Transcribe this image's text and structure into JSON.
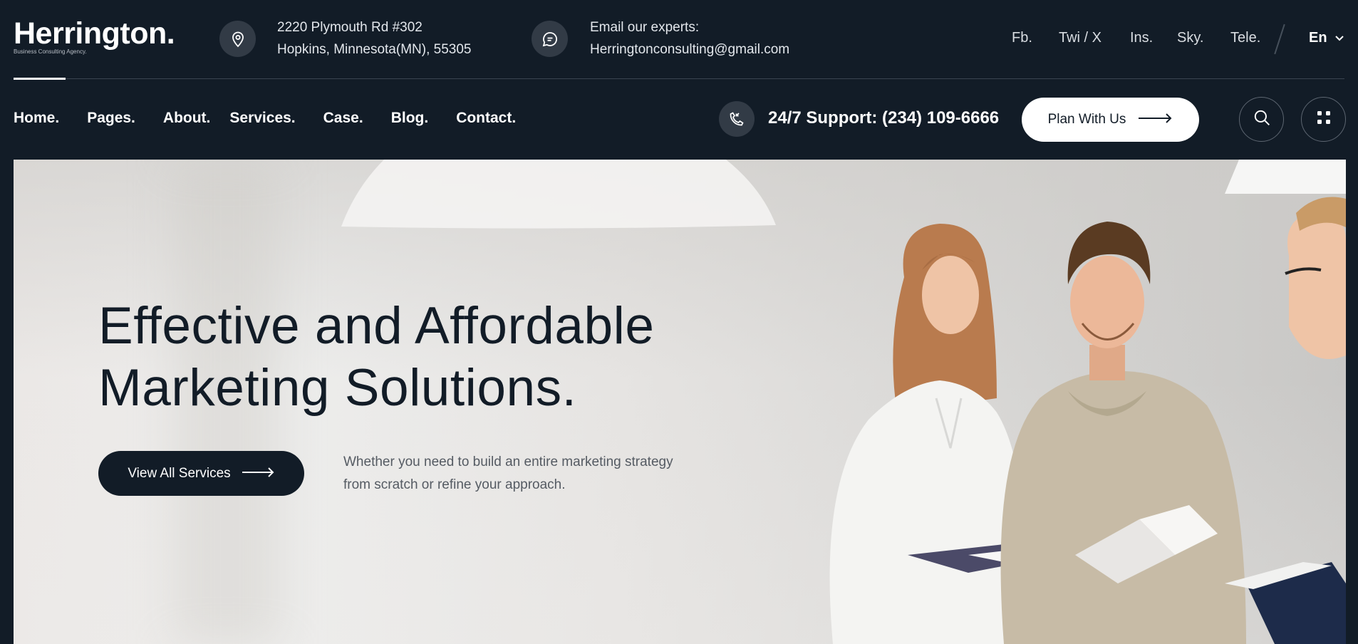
{
  "brand": {
    "name": "Herrington.",
    "tagline": "Business Consulting Agency."
  },
  "contact": {
    "address_line1": "2220 Plymouth Rd #302",
    "address_line2": "Hopkins, Minnesota(MN), 55305",
    "email_label": "Email our experts:",
    "email": "Herringtonconsulting@gmail.com"
  },
  "social": [
    "Fb.",
    "Twi / X",
    "Ins.",
    "Sky.",
    "Tele."
  ],
  "language": "En",
  "nav": {
    "items": [
      "Home.",
      "Pages.",
      "About.",
      "Services.",
      "Case.",
      "Blog.",
      "Contact."
    ],
    "support": "24/7 Support: (234) 109-6666",
    "plan_label": "Plan With Us"
  },
  "hero": {
    "title_line1": "Effective and Affordable",
    "title_line2": "Marketing Solutions.",
    "cta_label": "View All Services",
    "description_line1": "Whether you need to build an entire marketing strategy",
    "description_line2": "from scratch or refine your approach."
  },
  "icons": {
    "location": "location-pin-icon",
    "message": "chat-bubble-icon",
    "phone": "phone-call-icon",
    "arrow": "arrow-right-icon",
    "search": "search-icon",
    "menu": "grid-menu-icon",
    "chevron": "chevron-down-icon"
  },
  "colors": {
    "dark": "#121c27",
    "light": "#ffffff",
    "icon_bg": "#323b46"
  }
}
